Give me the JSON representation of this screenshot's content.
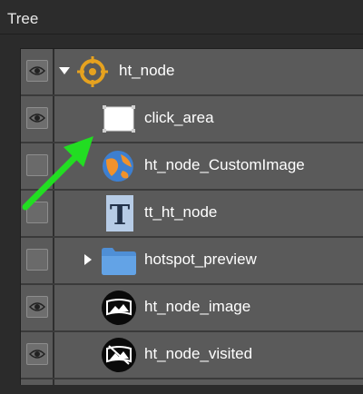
{
  "window": {
    "title": "Tree"
  },
  "tree": {
    "items": [
      {
        "label": "ht_node",
        "visible": true,
        "expanded": true,
        "icon": "crosshair-target-icon"
      },
      {
        "label": "click_area",
        "visible": true,
        "icon": "white-rectangle-icon"
      },
      {
        "label": "ht_node_CustomImage",
        "visible": false,
        "icon": "globe-image-icon"
      },
      {
        "label": "tt_ht_node",
        "visible": false,
        "icon": "text-T-icon"
      },
      {
        "label": "hotspot_preview",
        "visible": false,
        "expanded": false,
        "icon": "folder-icon"
      },
      {
        "label": "ht_node_image",
        "visible": true,
        "icon": "panorama-image-icon"
      },
      {
        "label": "ht_node_visited",
        "visible": true,
        "icon": "panorama-visited-icon"
      }
    ]
  },
  "colors": {
    "arrow": "#22dd22",
    "crosshair": "#e6a21f",
    "folder": "#4f8fd6"
  }
}
